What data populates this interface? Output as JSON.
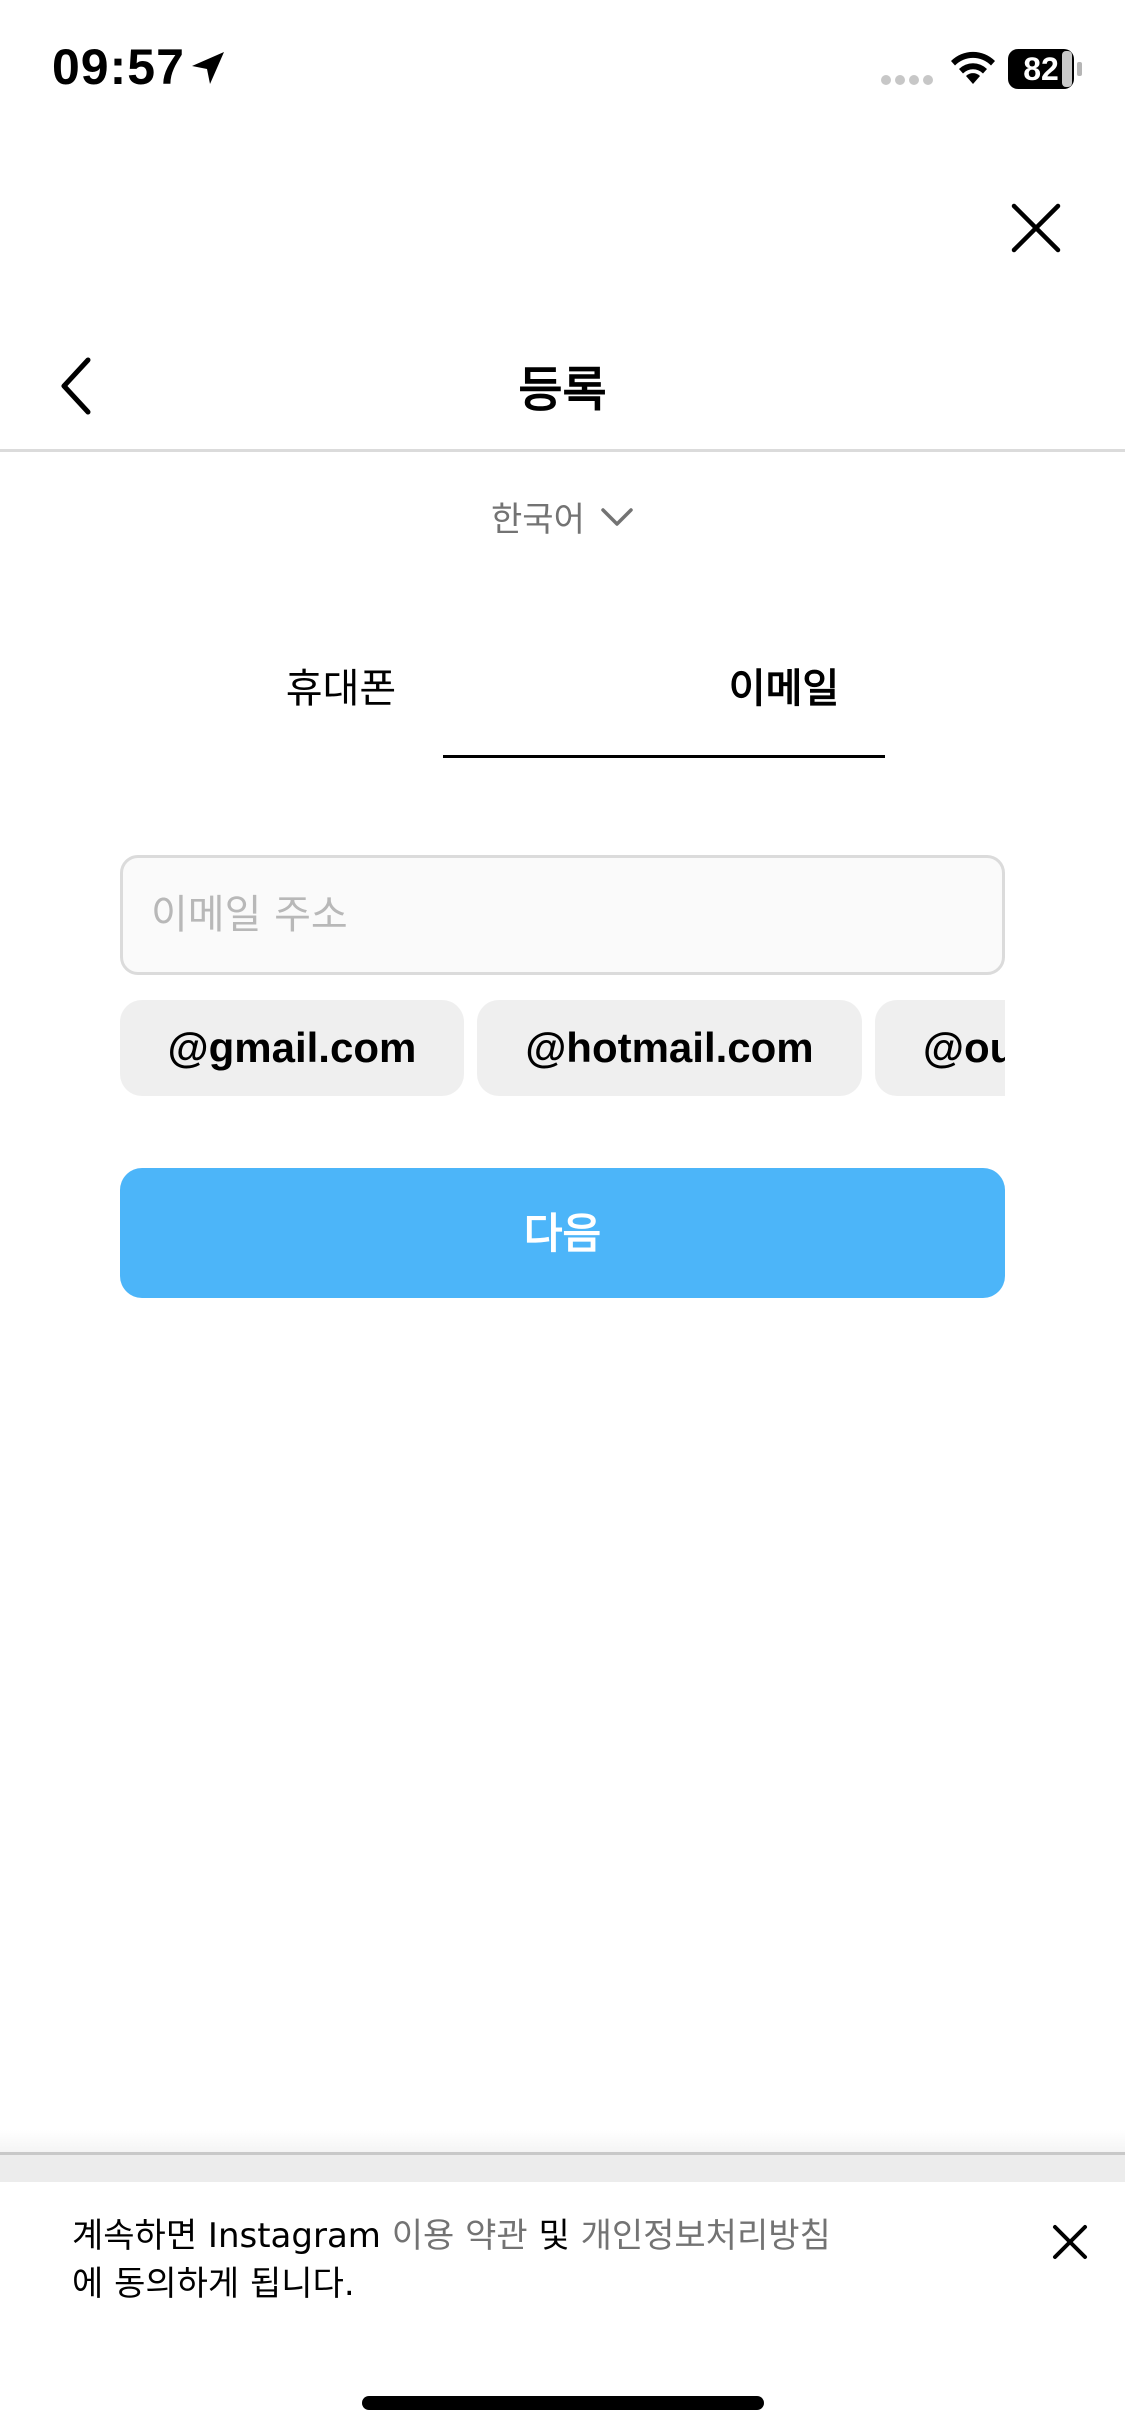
{
  "status_bar": {
    "time": "09:57",
    "battery": "82"
  },
  "header": {
    "title": "등록"
  },
  "language": {
    "label": "한국어"
  },
  "tabs": [
    {
      "label": "휴대폰",
      "selected": false
    },
    {
      "label": "이메일",
      "selected": true
    }
  ],
  "email": {
    "placeholder": "이메일 주소",
    "value": ""
  },
  "domain_suggestions": [
    "@gmail.com",
    "@hotmail.com",
    "@ou"
  ],
  "next_button": {
    "label": "다음"
  },
  "terms": {
    "prefix": "계속하면 Instagram ",
    "terms_link": "이용 약관",
    "middle": " 및 ",
    "privacy_link": "개인정보처리방침",
    "suffix": "에 동의하게 됩니다."
  },
  "colors": {
    "accent": "#4cb5f9",
    "chip_bg": "#efefef",
    "link_gray": "#737373"
  }
}
